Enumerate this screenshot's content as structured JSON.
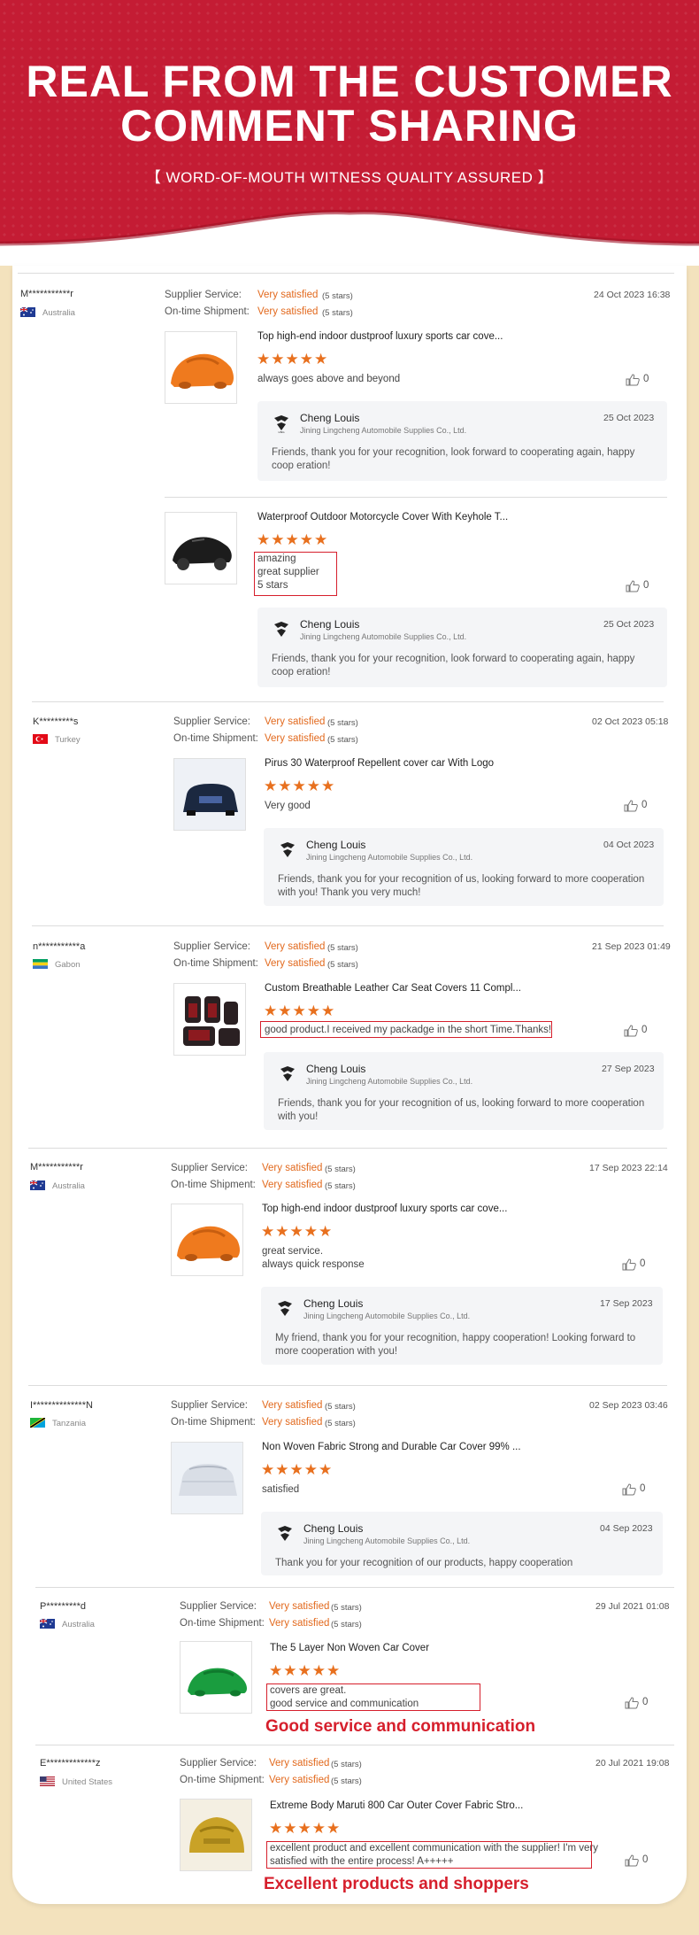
{
  "hero": {
    "title_line1": "REAL FROM THE CUSTOMER",
    "title_line2": "COMMENT SHARING",
    "subtitle": "【 WORD-OF-MOUTH WITNESS QUALITY ASSURED 】"
  },
  "labels": {
    "supplier_service": "Supplier Service:",
    "on_time_shipment": "On-time Shipment:"
  },
  "reply_common": {
    "name": "Cheng Louis",
    "company": "Jining Lingcheng Automobile Supplies Co., Ltd."
  },
  "reviews": [
    {
      "user": "M***********r",
      "country": "Australia",
      "date": "24 Oct 2023 16:38",
      "supplier": "Very satisfied",
      "supplier_stars": "(5 stars)",
      "shipment": "Very satisfied",
      "shipment_stars": "(5 stars)",
      "products": [
        {
          "title": "Top high-end indoor dustproof luxury sports car cove...",
          "stars": "★★★★★",
          "comment": "always goes above and beyond",
          "likes": "0",
          "reply_date": "25 Oct 2023",
          "reply_text": "Friends, thank you for your recognition, look forward to cooperating again, happy coop eration!"
        },
        {
          "title": "Waterproof Outdoor Motorcycle Cover With Keyhole T...",
          "stars": "★★★★★",
          "comment": "amazing\ngreat supplier\n5 stars",
          "likes": "0",
          "reply_date": "25 Oct 2023",
          "reply_text": "Friends, thank you for your recognition, look forward to cooperating again, happy coop eration!"
        }
      ]
    },
    {
      "user": "K*********s",
      "country": "Turkey",
      "date": "02 Oct 2023 05:18",
      "supplier": "Very satisfied",
      "supplier_stars": "(5 stars)",
      "shipment": "Very satisfied",
      "shipment_stars": "(5 stars)",
      "products": [
        {
          "title": "Pirus 30 Waterproof Repellent cover car With Logo",
          "stars": "★★★★★",
          "comment": "Very good",
          "likes": "0",
          "reply_date": "04 Oct 2023",
          "reply_text": "Friends, thank you for your recognition of us, looking forward to more cooperation with you! Thank you very much!"
        }
      ]
    },
    {
      "user": "n***********a",
      "country": "Gabon",
      "date": "21 Sep 2023 01:49",
      "supplier": "Very satisfied",
      "supplier_stars": "(5 stars)",
      "shipment": "Very satisfied",
      "shipment_stars": "(5 stars)",
      "products": [
        {
          "title": "Custom Breathable Leather Car Seat Covers 11 Compl...",
          "stars": "★★★★★",
          "comment": "good product.I received my packadge in the short Time.Thanks!",
          "likes": "0",
          "reply_date": "27 Sep 2023",
          "reply_text": "Friends, thank you for your recognition of us, looking forward to more cooperation with you!"
        }
      ]
    },
    {
      "user": "M***********r",
      "country": "Australia",
      "date": "17 Sep 2023 22:14",
      "supplier": "Very satisfied",
      "supplier_stars": "(5 stars)",
      "shipment": "Very satisfied",
      "shipment_stars": "(5 stars)",
      "products": [
        {
          "title": "Top high-end indoor dustproof luxury sports car cove...",
          "stars": "★★★★★",
          "comment": "great service.\nalways quick response",
          "likes": "0",
          "reply_date": "17 Sep 2023",
          "reply_text": "My friend, thank you for your recognition, happy cooperation! Looking forward to more cooperation with you!"
        }
      ]
    },
    {
      "user": "I**************N",
      "country": "Tanzania",
      "date": "02 Sep 2023 03:46",
      "supplier": "Very satisfied",
      "supplier_stars": "(5 stars)",
      "shipment": "Very satisfied",
      "shipment_stars": "(5 stars)",
      "products": [
        {
          "title": "Non Woven Fabric Strong and Durable Car Cover 99% ...",
          "stars": "★★★★★",
          "comment": "satisfied",
          "likes": "0",
          "reply_date": "04 Sep 2023",
          "reply_text": "Thank you for your recognition of our products, happy cooperation"
        }
      ]
    },
    {
      "user": "P*********d",
      "country": "Australia",
      "date": "29 Jul 2021 01:08",
      "supplier": "Very satisfied",
      "supplier_stars": "(5 stars)",
      "shipment": "Very satisfied",
      "shipment_stars": "(5 stars)",
      "products": [
        {
          "title": "The 5 Layer Non Woven Car Cover",
          "stars": "★★★★★",
          "comment": "covers are great.\ngood service and communication",
          "likes": "0"
        }
      ],
      "banner": "Good service and communication"
    },
    {
      "user": "E*************z",
      "country": "United States",
      "date": "20 Jul 2021 19:08",
      "supplier": "Very satisfied",
      "supplier_stars": "(5 stars)",
      "shipment": "Very satisfied",
      "shipment_stars": "(5 stars)",
      "products": [
        {
          "title": "Extreme Body Maruti 800 Car Outer Cover Fabric Stro...",
          "stars": "★★★★★",
          "comment": "excellent product and excellent communication with the supplier! I'm very\nsatisfied with the entire process! A+++++",
          "likes": "0"
        }
      ],
      "banner": "Excellent products and shoppers"
    }
  ],
  "colors": {
    "hero": "#c41c34",
    "accent": "#e2691d",
    "highlight": "#d61f2c",
    "page": "#f3e2bd"
  }
}
